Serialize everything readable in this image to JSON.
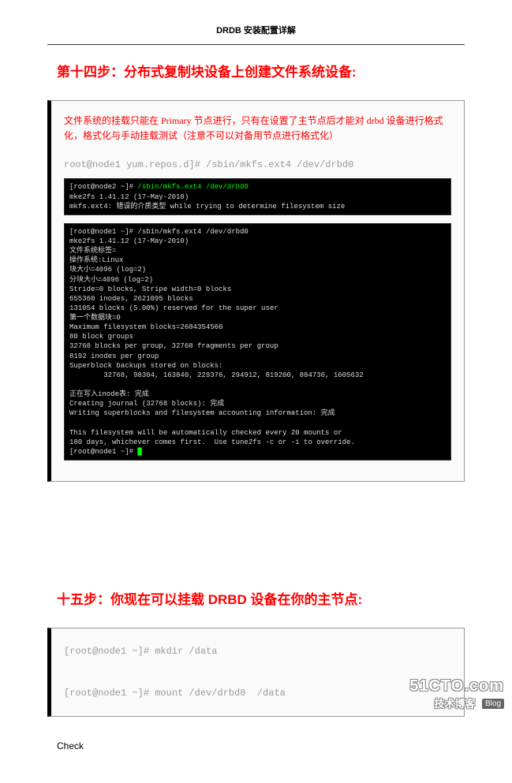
{
  "header": {
    "title": "DRDB 安装配置详解"
  },
  "step14": {
    "title": "第十四步：分布式复制块设备上创建文件系统设备:",
    "redtext": "文件系统的挂载只能在 Primary 节点进行，只有在设置了主节点后才能对 drbd 设备进行格式化，格式化与手动挂载测试（注意不可以对备用节点进行格式化）",
    "graycmd": "root@node1 yum.repos.d]# /sbin/mkfs.ext4 /dev/drbd0",
    "term1_line1_host": "[root@node2 ~]# ",
    "term1_line1_cmd": "/sbin/mkfs.ext4 /dev/drbd0",
    "term1_line2": "mke2fs 1.41.12 (17-May-2010)",
    "term1_line3": "mkfs.ext4: 错误的介质类型 while trying to determine filesystem size",
    "term2": "[root@node1 ~]# /sbin/mkfs.ext4 /dev/drbd0\nmke2fs 1.41.12 (17-May-2010)\n文件系统标签=\n操作系统:Linux\n块大小=4096 (log=2)\n分块大小=4096 (log=2)\nStride=0 blocks, Stripe width=0 blocks\n655360 inodes, 2621095 blocks\n131054 blocks (5.00%) reserved for the super user\n第一个数据块=0\nMaximum filesystem blocks=2684354560\n80 block groups\n32768 blocks per group, 32768 fragments per group\n8192 inodes per group\nSuperblock backups stored on blocks:\n        32768, 98304, 163840, 229376, 294912, 819200, 884736, 1605632\n\n正在写入inode表: 完成\nCreating journal (32768 blocks): 完成\nWriting superblocks and filesystem accounting information: 完成\n\nThis filesystem will be automatically checked every 20 mounts or\n180 days, whichever comes first.  Use tune2fs -c or -i to override.",
    "term2_prompt": "[root@node1 ~]# "
  },
  "step15": {
    "title": "十五步：你现在可以挂载 DRBD 设备在你的主节点:",
    "graycmds": "[root@node1 ~]# mkdir /data\n\n[root@node1 ~]# mount /dev/drbd0  /data"
  },
  "footer": {
    "text": "Check"
  },
  "watermark": {
    "top": "51CTO.com",
    "bottom": "技术博客",
    "blog": "Blog"
  }
}
